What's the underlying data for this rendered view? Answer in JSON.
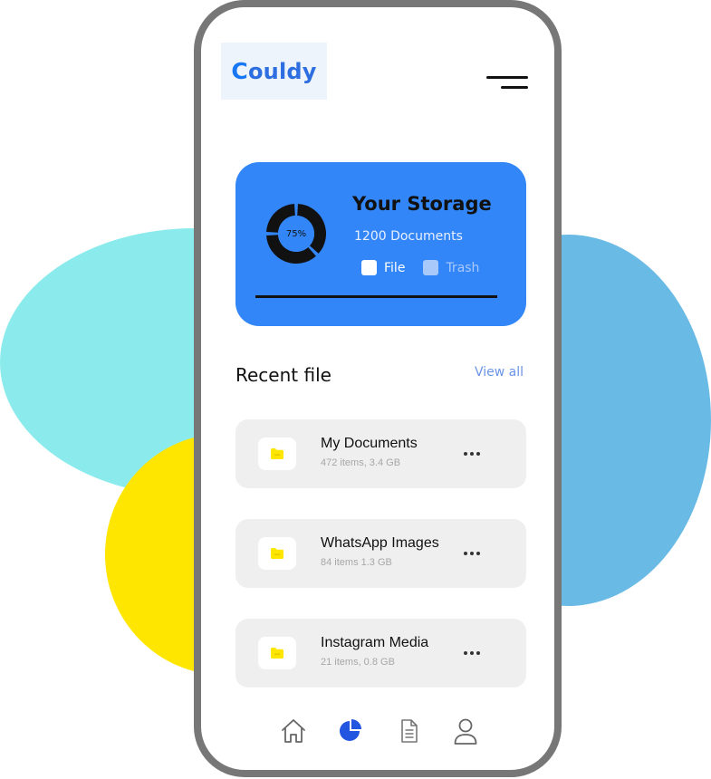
{
  "app": {
    "name": "Couldy",
    "logo_initial": "C",
    "logo_rest": "ouldy"
  },
  "storage": {
    "title": "Your Storage",
    "documents": "1200 Documents",
    "percent_label": "75%",
    "used_fraction": 0.75,
    "legend": [
      {
        "label": "File",
        "color": "#ffffff",
        "text_color": "#ffffff"
      },
      {
        "label": "Trash",
        "color": "#a9c9fb",
        "text_color": "#a9c9fb"
      }
    ]
  },
  "recent": {
    "title": "Recent file",
    "view_all": "View all",
    "files": [
      {
        "name": "My Documents",
        "meta": "472 items, 3.4 GB"
      },
      {
        "name": "WhatsApp Images",
        "meta": "84 items 1.3 GB"
      },
      {
        "name": "Instagram Media",
        "meta": "21 items, 0.8 GB"
      }
    ]
  },
  "nav": {
    "items": [
      "home-icon",
      "pie-chart-icon",
      "document-icon",
      "user-icon"
    ],
    "active": "pie-chart-icon"
  },
  "colors": {
    "accent": "#3286f8",
    "folder": "#ffe600",
    "blob_cyan": "#8bebec",
    "blob_yellow": "#ffe600",
    "blob_blue": "#6abae6",
    "phone_frame": "#777777"
  }
}
